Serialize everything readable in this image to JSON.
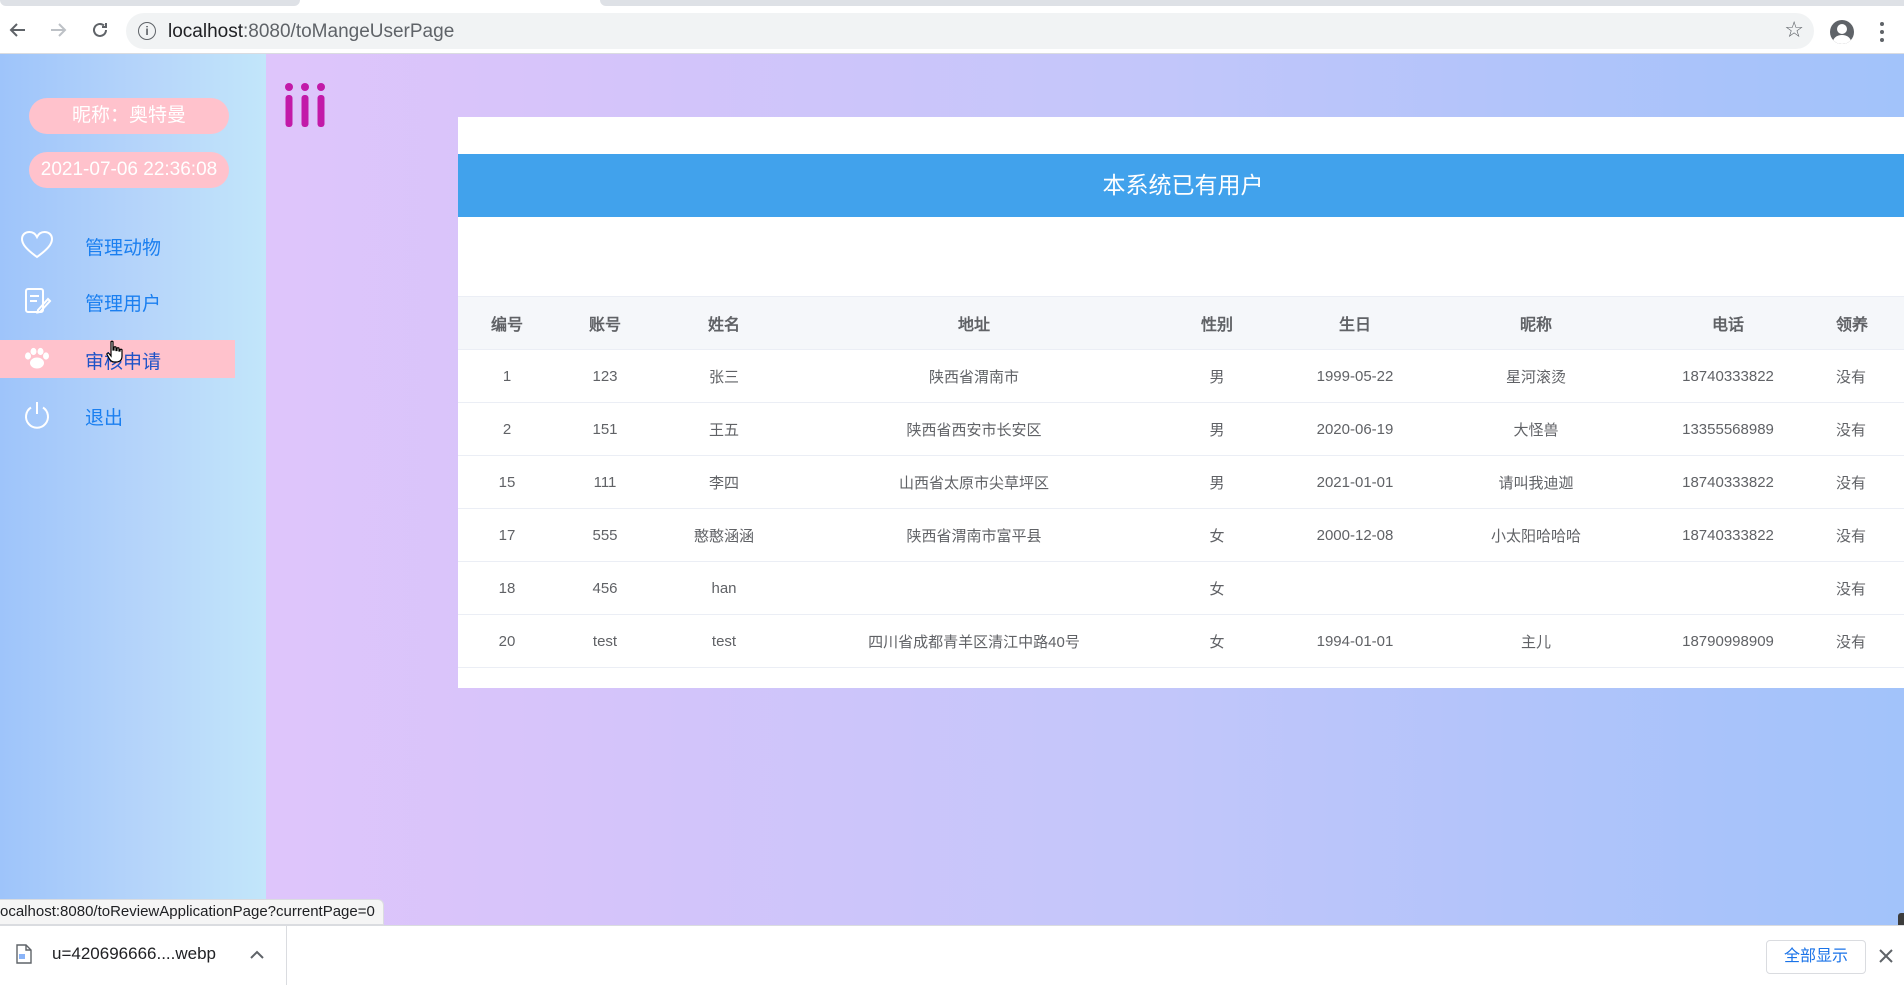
{
  "browser": {
    "url_host": "localhost",
    "url_path": ":8080/toMangeUserPage",
    "status_url": "ocalhost:8080/toReviewApplicationPage?currentPage=0"
  },
  "sidebar": {
    "nickname": "昵称：奥特曼",
    "datetime": "2021-07-06 22:36:08",
    "items": [
      {
        "label": "管理动物",
        "icon": "heart-icon"
      },
      {
        "label": "管理用户",
        "icon": "edit-document-icon"
      },
      {
        "label": "审核申请",
        "icon": "paw-icon",
        "active": true
      },
      {
        "label": "退出",
        "icon": "power-icon"
      }
    ]
  },
  "card": {
    "title": "本系统已有用户"
  },
  "table": {
    "headers": [
      "编号",
      "账号",
      "姓名",
      "地址",
      "性别",
      "生日",
      "昵称",
      "电话",
      "领养"
    ],
    "rows": [
      [
        "1",
        "123",
        "张三",
        "陕西省渭南市",
        "男",
        "1999-05-22",
        "星河滚烫",
        "18740333822",
        "没有"
      ],
      [
        "2",
        "151",
        "王五",
        "陕西省西安市长安区",
        "男",
        "2020-06-19",
        "大怪兽",
        "13355568989",
        "没有"
      ],
      [
        "15",
        "111",
        "李四",
        "山西省太原市尖草坪区",
        "男",
        "2021-01-01",
        "请叫我迪迦",
        "18740333822",
        "没有"
      ],
      [
        "17",
        "555",
        "憨憨涵涵",
        "陕西省渭南市富平县",
        "女",
        "2000-12-08",
        "小太阳哈哈哈",
        "18740333822",
        "没有"
      ],
      [
        "18",
        "456",
        "han",
        "",
        "女",
        "",
        "",
        "",
        "没有"
      ],
      [
        "20",
        "test",
        "test",
        "四川省成都青羊区清江中路40号",
        "女",
        "1994-01-01",
        "主儿",
        "18790998909",
        "没有"
      ]
    ]
  },
  "downloads": {
    "file_name": "u=420696666....webp",
    "show_all_label": "全部显示"
  },
  "colors": {
    "header_blue": "#41a2ec",
    "pill_pink": "#ffc2cc",
    "menu_link": "#1a7ff0",
    "logo_magenta": "#c21aa8"
  }
}
